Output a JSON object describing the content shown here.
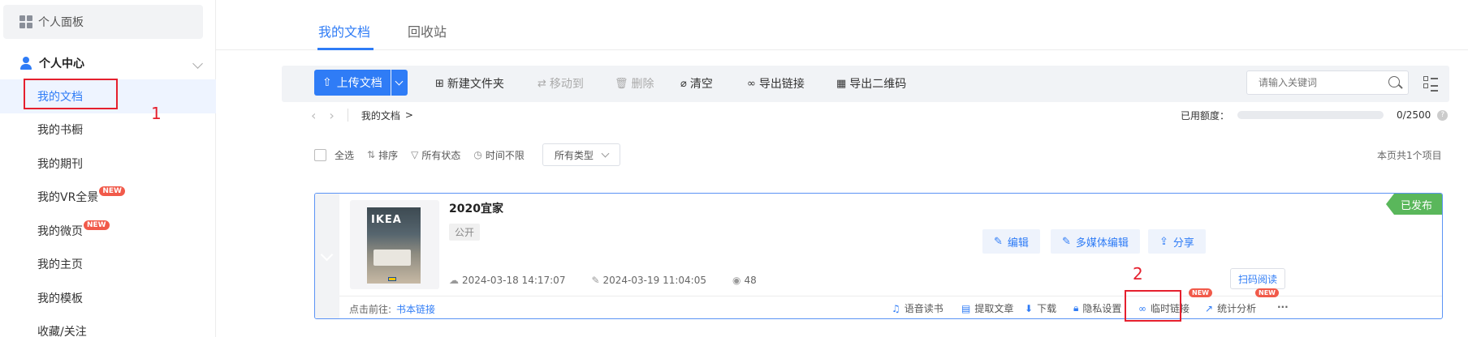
{
  "sidebar": {
    "dashboard_label": "个人面板",
    "section_label": "个人中心",
    "items": [
      {
        "label": "我的文档",
        "new": false
      },
      {
        "label": "我的书橱",
        "new": false
      },
      {
        "label": "我的期刊",
        "new": false
      },
      {
        "label": "我的VR全景",
        "new": true
      },
      {
        "label": "我的微页",
        "new": true
      },
      {
        "label": "我的主页",
        "new": false
      },
      {
        "label": "我的模板",
        "new": false
      },
      {
        "label": "收藏/关注",
        "new": false
      }
    ],
    "new_badge": "NEW"
  },
  "annotations": {
    "one": "1",
    "two": "2"
  },
  "tabs": [
    "我的文档",
    "回收站"
  ],
  "toolbar": {
    "upload": "上传文档",
    "new_folder": "新建文件夹",
    "move_to": "移动到",
    "delete": "删除",
    "clear": "清空",
    "export_link": "导出链接",
    "export_qr": "导出二维码",
    "search_placeholder": "请输入关键词"
  },
  "breadcrumb": {
    "current": "我的文档",
    "separator": ">"
  },
  "quota": {
    "label": "已用额度：",
    "used_text": "0/2500",
    "fraction": 0.0
  },
  "filters": {
    "select_all": "全选",
    "sort": "排序",
    "status": "所有状态",
    "time": "时间不限",
    "type": "所有类型"
  },
  "page_count": "本页共1个项目",
  "document": {
    "title": "2020宜家",
    "visibility": "公开",
    "status": "已发布",
    "cover_logo": "IKEA",
    "uploaded": "2024-03-18 14:17:07",
    "modified": "2024-03-19 11:04:05",
    "views": "48",
    "actions": {
      "edit": "编辑",
      "media_edit": "多媒体编辑",
      "share": "分享",
      "scan": "扫码阅读"
    },
    "footer": {
      "goto_label": "点击前往:",
      "book_link": "书本链接",
      "audio": "语音读书",
      "extract": "提取文章",
      "download": "下载",
      "privacy": "隐私设置",
      "temp_link": "临时链接",
      "analytics": "统计分析",
      "more": "···"
    }
  },
  "colors": {
    "accent": "#2f7cf6",
    "published": "#5ab75b",
    "annotation": "#e5202e",
    "new_badge": "#f15a4a"
  }
}
